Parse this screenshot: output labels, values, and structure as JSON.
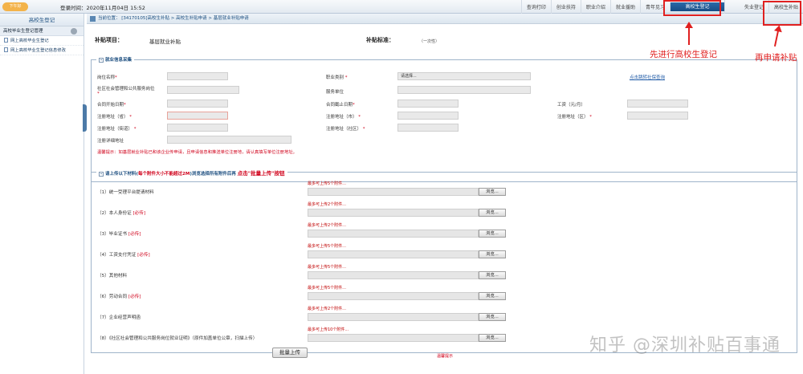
{
  "header": {
    "logo_text": "下午好",
    "login_time": "登录时间：2020年11月04日 15:52",
    "nav": [
      {
        "label": "查询打印"
      },
      {
        "label": "创业扶持"
      },
      {
        "label": "职业介绍"
      },
      {
        "label": "就业援助"
      },
      {
        "label": "青年见习"
      },
      {
        "label": "高校生登记",
        "active": true
      },
      {
        "label": "失业登记"
      },
      {
        "label": "高校生补贴"
      }
    ]
  },
  "sidebar": {
    "title": "高校生登记",
    "section": "高校毕业生登记管理",
    "items": [
      {
        "label": "网上高校毕业生登记"
      },
      {
        "label": "网上高校毕业生登记信息修改"
      }
    ]
  },
  "breadcrumb": "当前位置：  [34170105]高校生补贴 > 高校生补贴申请 > 基层就业补贴申请",
  "subsidy": {
    "item_label": "补贴项目：",
    "item_value": "基层就业补贴",
    "std_label": "补贴标准：",
    "std_value": "（一次性）"
  },
  "employment": {
    "legend": "就业信息采集",
    "fields": {
      "position": "岗位名称",
      "job_type": "职业类别",
      "job_type_value": "请选择...",
      "social_post": "社区社会管理和公共服务岗位",
      "service_unit": "服务单位",
      "start_date": "合同开始日期",
      "end_date": "合同截止日期",
      "wage": "工资（元/月）",
      "reg_province": "注册地址（省）",
      "reg_city": "注册地址（市）",
      "reg_district": "注册地址（区）",
      "reg_street": "注册地址（街道）",
      "reg_community": "注册地址（社区）",
      "reg_detail": "注册详细地址"
    },
    "social_link": "点击跳转社保查询",
    "tip": "温馨提示：如基层就业补贴已和该企业传申请，且申请信息和推送单位注册地，请认真填写单位注册地址。"
  },
  "attachments": {
    "legend": "请上传以下材料(",
    "legend_red": "每个附件大小不能超过2M",
    "legend_tail": ")浏览选择所有附件后再",
    "legend_action": "点击\"批量上传\"按钮",
    "required_mark": "[必传]",
    "browse_label": "浏览...",
    "items": [
      {
        "label": "（1）统一受理平台提请材料",
        "required": false,
        "limit": "最多可上传5个附件..."
      },
      {
        "label": "（2）本人身份证",
        "required": true,
        "limit": "最多可上传2个附件..."
      },
      {
        "label": "（3）毕业证书",
        "required": true,
        "limit": "最多可上传2个附件..."
      },
      {
        "label": "（4）工资支付凭证",
        "required": true,
        "limit": "最多可上传5个附件..."
      },
      {
        "label": "（5）其他材料",
        "required": false,
        "limit": "最多可上传5个附件..."
      },
      {
        "label": "（6）劳动合同",
        "required": true,
        "limit": "最多可上传5个附件..."
      },
      {
        "label": "（7）企业经营声明函",
        "required": false,
        "limit": "最多可上传2个附件..."
      },
      {
        "label": "（8）《社区社会管理和公共服务岗位就业证明》（原件加盖单位公章，扫描上传）",
        "required": false,
        "limit": "最多可上传10个附件..."
      }
    ],
    "batch_upload": "批量上传",
    "save_tip": "温馨提示"
  },
  "annotations": {
    "first": "先进行高校生登记",
    "second": "再申请补贴"
  },
  "watermark": "知乎 @深圳补贴百事通"
}
